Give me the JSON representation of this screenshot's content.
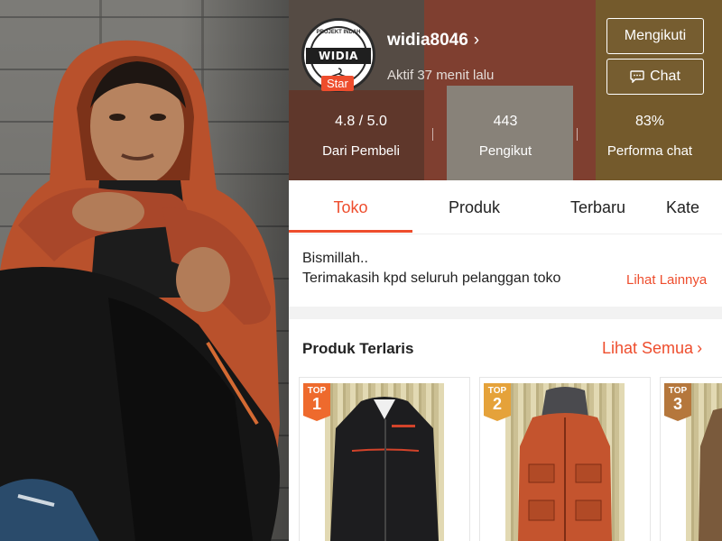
{
  "photo": {
    "description_icon": "person-photo"
  },
  "shop": {
    "name": "widia8046",
    "logo_text": "WIDIA 8046",
    "logo_arc_text": "PROJEKT INDAH",
    "badge": "Star",
    "active_status": "Aktif 37 menit lalu",
    "follow_label": "Mengikuti",
    "chat_label": "Chat",
    "stats": [
      {
        "value": "4.8 / 5.0",
        "label": "Dari Pembeli"
      },
      {
        "value": "443",
        "label": "Pengikut"
      },
      {
        "value": "83%",
        "label": "Performa chat"
      }
    ],
    "tabs": [
      "Toko",
      "Produk",
      "Terbaru",
      "Kate"
    ],
    "active_tab": "Toko",
    "description": {
      "line1": "Bismillah..",
      "line2": "Terimakasih kpd seluruh pelanggan toko",
      "see_more": "Lihat Lainnya"
    },
    "best_sellers": {
      "title": "Produk Terlaris",
      "see_all": "Lihat Semua",
      "products": [
        {
          "badge_top": "TOP",
          "rank": "1",
          "badge_color": "#ee6a2d"
        },
        {
          "badge_top": "TOP",
          "rank": "2",
          "badge_color": "#e5a23a"
        },
        {
          "badge_top": "TOP",
          "rank": "3",
          "badge_color": "#b5773c"
        }
      ]
    },
    "colors": {
      "accent": "#ee4d2d"
    }
  }
}
